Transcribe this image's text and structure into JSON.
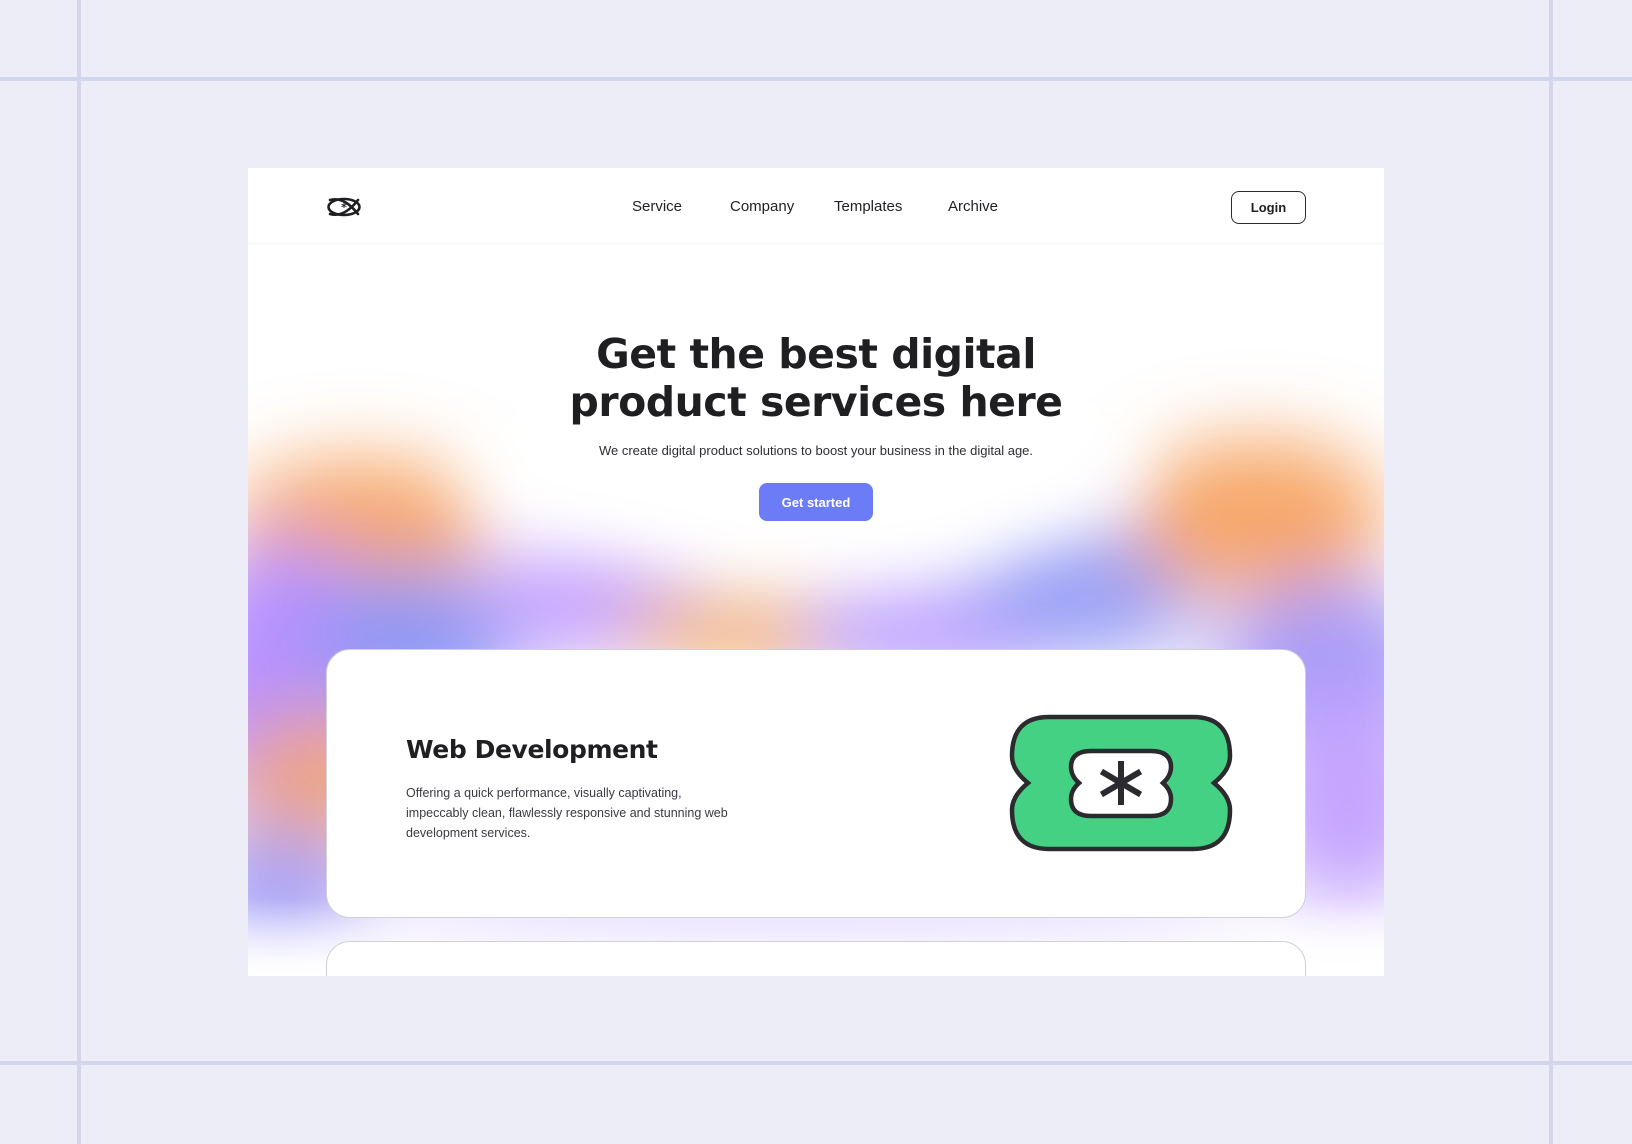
{
  "nav": {
    "logo_icon": "atom-logo-icon",
    "items": [
      {
        "label": "Service"
      },
      {
        "label": "Company"
      },
      {
        "label": "Templates"
      },
      {
        "label": "Archive"
      }
    ],
    "login_label": "Login"
  },
  "hero": {
    "title_line1": "Get the best digital",
    "title_line2": "product services here",
    "subtitle": "We create digital product solutions to boost your business in the digital age.",
    "cta_label": "Get started"
  },
  "services": [
    {
      "title": "Web Development",
      "description": "Offering a quick performance, visually captivating, impeccably clean, flawlessly responsive and stunning web development services.",
      "icon": "asterisk-badge-icon",
      "icon_color": "#45d184"
    }
  ],
  "colors": {
    "accent": "#6b7cf6",
    "page_bg": "#ecedf7",
    "text": "#1f1f22",
    "blob_orange": "#f7a769",
    "blob_purple": "#b891ff",
    "blob_blue": "#8f98f4"
  }
}
